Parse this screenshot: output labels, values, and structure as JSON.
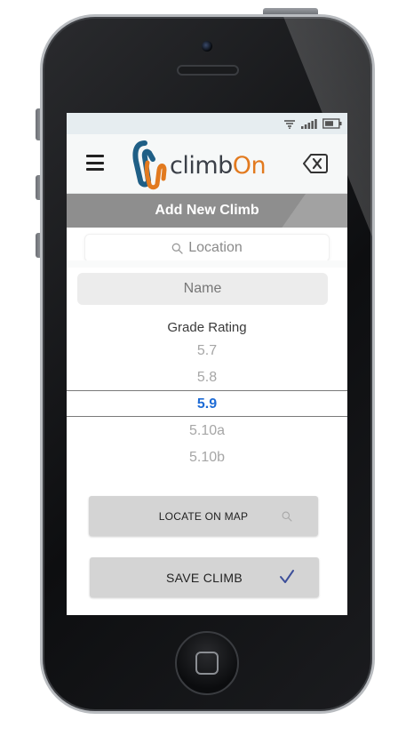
{
  "app": {
    "logo": {
      "brand_prefix": "climb",
      "brand_suffix": "On"
    }
  },
  "screen": {
    "title": "Add New Climb",
    "location_search": {
      "placeholder": "Location"
    },
    "name_field": {
      "placeholder": "Name"
    },
    "grade_rating": {
      "label": "Grade Rating",
      "options": [
        "5.7",
        "5.8",
        "5.9",
        "5.10a",
        "5.10b"
      ],
      "selected": "5.9"
    },
    "buttons": {
      "locate_on_map": "LOCATE ON MAP",
      "save_climb": "SAVE CLIMB"
    }
  },
  "colors": {
    "title_bar": "#8e8e8e",
    "selected_grade": "#1f6cd6",
    "logo_accent": "#e27a1f",
    "logo_carabiner": "#1f5f86",
    "button": "#d4d4d4",
    "checkmark": "#3d4f9a"
  },
  "icons": {
    "status": [
      "wifi-icon",
      "signal-bars-icon",
      "battery-icon"
    ],
    "header": [
      "hamburger-menu-icon",
      "close-icon"
    ],
    "buttons": [
      "search-icon",
      "checkmark-icon"
    ]
  }
}
